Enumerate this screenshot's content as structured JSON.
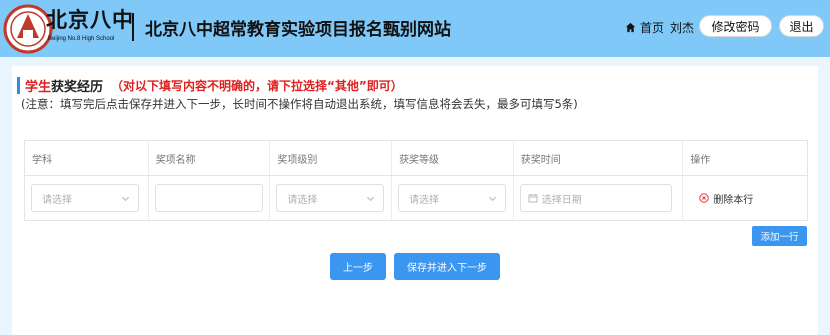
{
  "header": {
    "logo_script": "北京八中",
    "logo_en": "Beijing No.8 High School",
    "site_title": "北京八中超常教育实验项目报名甄别网站",
    "home_label": "首页",
    "user_name": "刘杰",
    "change_password_label": "修改密码",
    "logout_label": "退出"
  },
  "section": {
    "title_red": "学生",
    "title_black": "获奖经历",
    "warning": "（对以下填写内容不明确的，请下拉选择“其他”即可）",
    "notice": "(注意：填写完后点击保存并进入下一步，长时间不操作将自动退出系统，填写信息将会丢失，最多可填写5条)"
  },
  "table": {
    "columns": [
      "学科",
      "奖项名称",
      "奖项级别",
      "获奖等级",
      "获奖时间",
      "操作"
    ],
    "row": {
      "subject_placeholder": "请选择",
      "award_name_value": "",
      "award_level_placeholder": "请选择",
      "award_grade_placeholder": "请选择",
      "date_placeholder": "选择日期",
      "delete_label": "删除本行"
    }
  },
  "buttons": {
    "add_row": "添加一行",
    "prev": "上一步",
    "save_next": "保存并进入下一步"
  },
  "colors": {
    "header_bg": "#7fc8f8",
    "page_bg": "#eaf5fd",
    "primary": "#3a96f0",
    "warning_red": "#e02020"
  }
}
